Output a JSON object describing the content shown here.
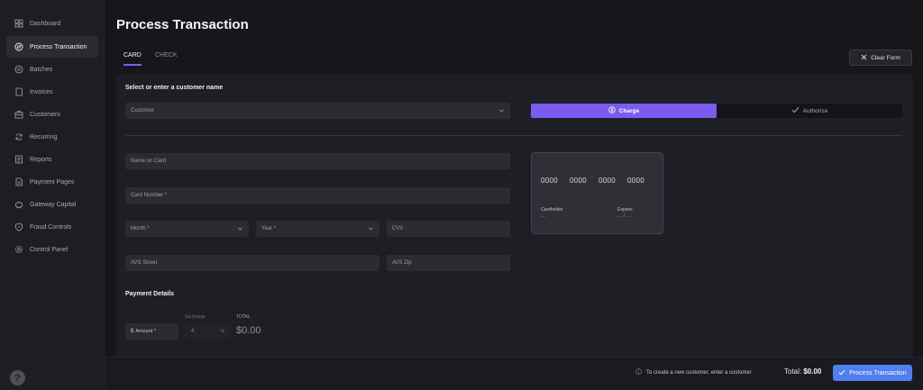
{
  "sidebar": {
    "items": [
      {
        "label": "Dashboard",
        "icon": "dashboard-icon",
        "active": false
      },
      {
        "label": "Process Transaction",
        "icon": "transaction-icon",
        "active": true
      },
      {
        "label": "Batches",
        "icon": "batches-icon",
        "active": false
      },
      {
        "label": "Invoices",
        "icon": "invoice-icon",
        "active": false
      },
      {
        "label": "Customers",
        "icon": "briefcase-icon",
        "active": false
      },
      {
        "label": "Recurring",
        "icon": "recurring-icon",
        "active": false
      },
      {
        "label": "Reports",
        "icon": "reports-icon",
        "active": false
      },
      {
        "label": "Payment Pages",
        "icon": "document-icon",
        "active": false
      },
      {
        "label": "Gateway Capital",
        "icon": "piggy-bank-icon",
        "active": false
      },
      {
        "label": "Fraud Controls",
        "icon": "shield-icon",
        "active": false
      },
      {
        "label": "Control Panel",
        "icon": "gear-icon",
        "active": false
      }
    ],
    "help_label": "?"
  },
  "header": {
    "title": "Process Transaction",
    "tabs": [
      {
        "label": "CARD",
        "active": true
      },
      {
        "label": "CHECK",
        "active": false
      }
    ],
    "clear_label": "Clear Form"
  },
  "form": {
    "customer_heading": "Select or enter a customer name",
    "customer_placeholder": "Customer",
    "mode": {
      "charge_label": "Charge",
      "authorize_label": "Authorize",
      "selected": "Charge"
    },
    "name_placeholder": "Name on Card",
    "card_number_placeholder": "Card Number *",
    "month_placeholder": "Month *",
    "year_placeholder": "Year *",
    "cvv_placeholder": "CVV",
    "avs_street_placeholder": "AVS Street",
    "avs_zip_placeholder": "AVS Zip"
  },
  "card_preview": {
    "groups": [
      "0000",
      "0000",
      "0000",
      "0000"
    ],
    "cardholder_label": "Cardholder",
    "cardholder_value": "...",
    "expires_label": "Expires",
    "expires_value": "... / ..."
  },
  "payment": {
    "heading": "Payment Details",
    "currency_symbol": "$",
    "amount_placeholder": "Amount *",
    "surcharge_label": "Surcharge",
    "surcharge_value": "4",
    "surcharge_unit": "%",
    "total_label": "TOTAL",
    "total_value": "$0.00"
  },
  "footer": {
    "hint": "To create a new customer, enter a customer",
    "total_label": "Total:",
    "total_value": "$0.00",
    "process_label": "Process Transaction"
  },
  "colors": {
    "accent_purple": "#7b5cf0",
    "primary_blue": "#4f7ff0",
    "background": "#16171b",
    "panel": "#1e1f24"
  }
}
